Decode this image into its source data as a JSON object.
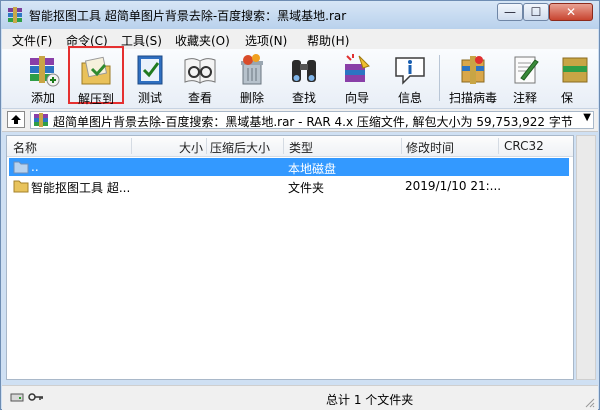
{
  "window": {
    "title": "智能抠图工具 超简单图片背景去除-百度搜索：黑域基地.rar",
    "min_glyph": "—",
    "max_glyph": "☐",
    "close_glyph": "✕"
  },
  "menu": [
    "文件(F)",
    "命令(C)",
    "工具(S)",
    "收藏夹(O)",
    "选项(N)",
    "帮助(H)"
  ],
  "toolbar": {
    "add": "添加",
    "extract": "解压到",
    "test": "测试",
    "view": "查看",
    "delete": "删除",
    "find": "查找",
    "wizard": "向导",
    "info": "信息",
    "scan": "扫描病毒",
    "comment": "注释",
    "protect": "保"
  },
  "address": {
    "text": "超简单图片背景去除-百度搜索：黑域基地.rar - RAR 4.x 压缩文件, 解包大小为 59,753,922 字节",
    "arrow": "▼"
  },
  "columns": {
    "name": "名称",
    "size": "大小",
    "packed": "压缩后大小",
    "type": "类型",
    "modified": "修改时间",
    "crc": "CRC32"
  },
  "rows": [
    {
      "name": "..",
      "type": "本地磁盘",
      "modified": ""
    },
    {
      "name": "智能抠图工具 超...",
      "type": "文件夹",
      "modified": "2019/1/10 21:..."
    }
  ],
  "status": {
    "summary": "总计 1 个文件夹"
  },
  "colors": {
    "selection": "#3399ff",
    "highlight_border": "#e53030"
  }
}
